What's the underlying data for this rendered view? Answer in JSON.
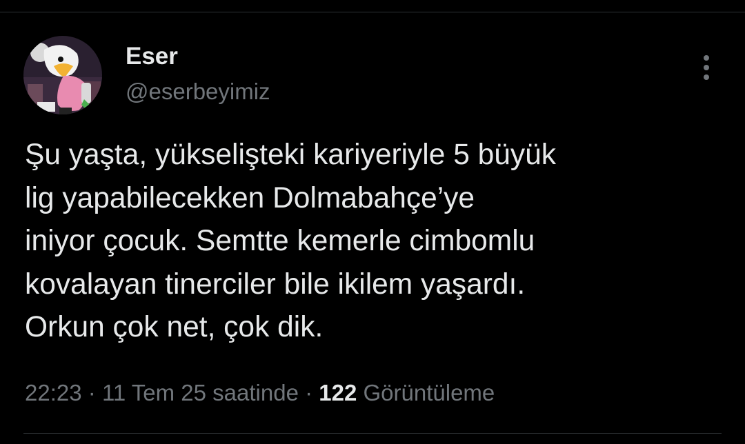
{
  "author": {
    "display_name": "Eser",
    "handle": "@eserbeyimiz",
    "avatar_icon": "eagle-avatar-icon"
  },
  "tweet": {
    "lines": [
      "Şu yaşta, yükselişteki kariyeriyle 5 büyük",
      "lig yapabilecekken Dolmabahçe’ye",
      "iniyor çocuk. Semtte kemerle cimbomlu",
      "kovalayan tinerciler bile ikilem yaşardı.",
      "Orkun çok net, çok dik."
    ]
  },
  "meta": {
    "time": "22:23",
    "separator": "·",
    "date": "11 Tem 25 saatinde",
    "views_count": "122",
    "views_label": "Görüntüleme"
  },
  "menu": {
    "icon": "more-vertical-icon"
  },
  "colors": {
    "background": "#000000",
    "primary_text": "#e7e9ea",
    "secondary_text": "#71767b",
    "divider": "#2f3336"
  }
}
